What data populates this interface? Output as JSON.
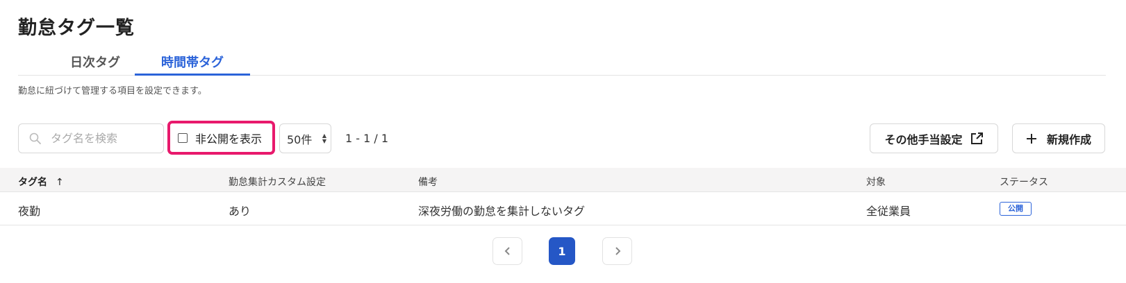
{
  "page": {
    "title": "勤怠タグ一覧",
    "description": "勤怠に紐づけて管理する項目を設定できます。"
  },
  "tabs": [
    {
      "label": "日次タグ",
      "active": false
    },
    {
      "label": "時間帯タグ",
      "active": true
    }
  ],
  "toolbar": {
    "search_placeholder": "タグ名を検索",
    "show_hidden_label": "非公開を表示",
    "show_hidden_checked": false,
    "per_page": "50件",
    "range": "1 - 1 / 1",
    "other_allowance_label": "その他手当設定",
    "new_label": "新規作成"
  },
  "table": {
    "columns": [
      "タグ名",
      "勤怠集計カスタム設定",
      "備考",
      "対象",
      "ステータス"
    ],
    "sort_icon": "↑",
    "rows": [
      {
        "name": "夜勤",
        "custom": "あり",
        "note": "深夜労働の勤怠を集計しないタグ",
        "target": "全従業員",
        "status": "公開"
      }
    ]
  },
  "pagination": {
    "current": "1",
    "prev_icon": "chevron-left-icon",
    "next_icon": "chevron-right-icon"
  },
  "colors": {
    "accent": "#2b63d9",
    "highlight": "#e8196c",
    "active_page": "#2557c6"
  }
}
